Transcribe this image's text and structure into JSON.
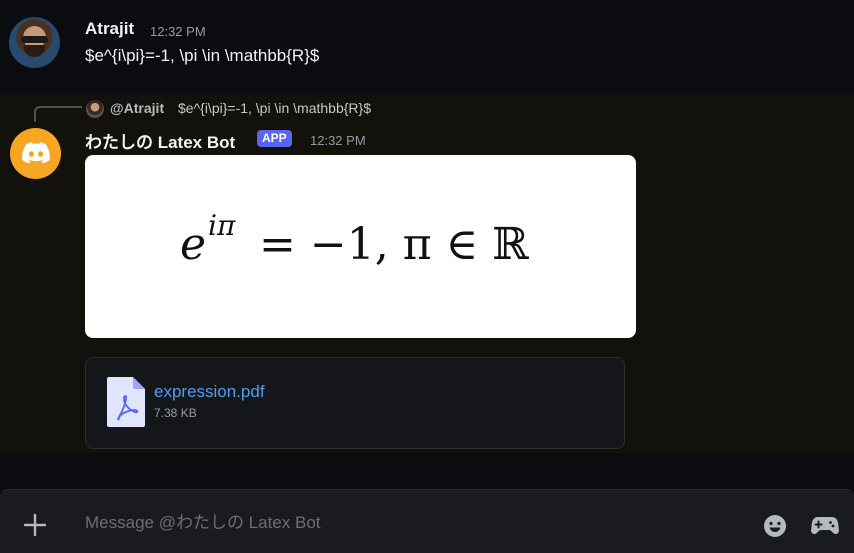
{
  "messages": {
    "user": {
      "username": "Atrajit",
      "timestamp": "12:32 PM",
      "text": "$e^{i\\pi}=-1, \\pi \\in \\mathbb{R}$"
    },
    "bot": {
      "reply_mention": "@Atrajit",
      "reply_text": "$e^{i\\pi}=-1, \\pi \\in \\mathbb{R}$",
      "name": "わたしの Latex Bot",
      "badge": "APP",
      "timestamp": "12:32 PM",
      "latex_render": {
        "e": "e",
        "exponent": "iπ",
        "rest": "= −1, π ∈ ℝ"
      },
      "attachment": {
        "file_name": "expression.pdf",
        "file_size": "7.38 KB"
      }
    }
  },
  "composer": {
    "placeholder": "Message @わたしの Latex Bot"
  },
  "colors": {
    "accent": "#5865f2",
    "link": "#4e9ff0",
    "bot_avatar": "#f6a623"
  },
  "icons": [
    "discord-logo-icon",
    "pdf-file-icon",
    "plus-icon",
    "emoji-icon",
    "gamepad-icon"
  ]
}
